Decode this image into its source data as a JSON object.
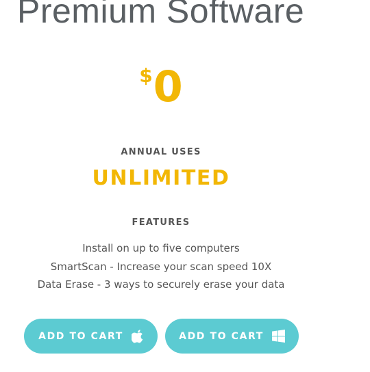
{
  "page": {
    "title": "Premium Software"
  },
  "price": {
    "currency": "$",
    "amount": "0",
    "color": "#f2b705"
  },
  "annual_uses": {
    "label": "ANNUAL USES",
    "value": "UNLIMITED"
  },
  "features": {
    "label": "FEATURES",
    "items": [
      "Install on up to five computers",
      "SmartScan - Increase your scan speed 10X",
      "Data Erase - 3 ways to securely erase your data"
    ]
  },
  "buttons": {
    "mac": {
      "label": "ADD TO CART",
      "icon": "apple-icon"
    },
    "windows": {
      "label": "ADD TO CART",
      "icon": "windows-icon"
    },
    "color": "#5ccbd2"
  }
}
